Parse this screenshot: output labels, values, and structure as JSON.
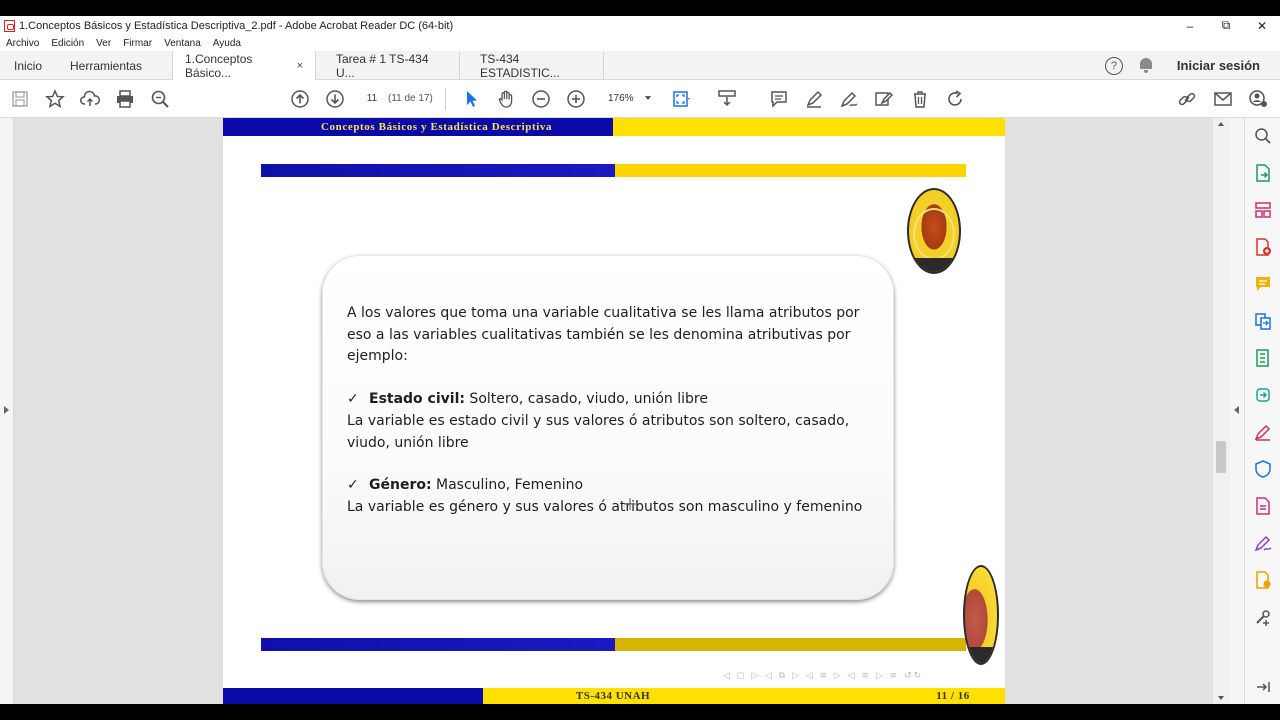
{
  "window": {
    "title": "1.Conceptos Básicos y Estadística Descriptiva_2.pdf - Adobe Acrobat Reader DC (64-bit)",
    "minimize": "–",
    "restore": "⧉",
    "close": "✕"
  },
  "menu": [
    "Archivo",
    "Edición",
    "Ver",
    "Firmar",
    "Ventana",
    "Ayuda"
  ],
  "tabs": {
    "home": "Inicio",
    "tools": "Herramientas",
    "doc1": "1.Conceptos Básico...",
    "doc1_close": "×",
    "doc2": "Tarea # 1 TS-434 U...",
    "doc3": "TS-434 ESTADISTIC...",
    "help": "?",
    "signin": "Iniciar sesión"
  },
  "toolbar": {
    "page_current": "11",
    "page_count": "(11 de 17)",
    "zoom": "176%"
  },
  "slide": {
    "header": "Conceptos Básicos y Estadística Descriptiva",
    "para1": "A los valores que toma una  variable cualitativa se les llama atributos por eso a las variables cualitativas también se les denomina atributivas por ejemplo:",
    "check": "✓",
    "item1_label": "Estado civil:",
    "item1_values": " Soltero, casado, viudo, unión libre",
    "item1_desc": "La variable es estado civil y sus valores ó atributos son soltero, casado, viudo, unión libre",
    "item2_label": "Género:",
    "item2_values": " Masculino, Femenino",
    "item2_desc": "La variable es género y sus valores ó atributos son masculino y femenino",
    "footer_left": "TS-434 UNAH",
    "footer_page": "11 / 16",
    "nav_glyphs": "◁ ◻ ▷ ◁ ⧉ ▷ ◁ ≡ ▷ ◁ ≡ ▷ ≡ ↺↻"
  },
  "colors": {
    "slide_blue": "#0a0aa8",
    "slide_yellow": "#ffe000",
    "header_text": "#ffe34a"
  },
  "icons": {
    "toolbar": [
      "save-icon",
      "bookmark-star-icon",
      "upload-cloud-icon",
      "print-icon",
      "search-zoom-icon",
      "prev-page-icon",
      "next-page-icon",
      "select-arrow-icon",
      "hand-tool-icon",
      "zoom-out-icon",
      "zoom-in-icon",
      "fit-page-icon",
      "scroll-mode-icon",
      "comment-icon",
      "highlight-pen-icon",
      "sign-icon",
      "edit-stamp-icon",
      "delete-icon",
      "rotate-icon",
      "share-link-icon",
      "email-icon",
      "user-share-icon"
    ],
    "right_panel": [
      "zoom-search-icon",
      "export-pdf-icon",
      "organize-pages-icon",
      "create-pdf-icon",
      "comment-icon",
      "combine-files-icon",
      "compress-icon",
      "protect-icon",
      "fill-sign-icon",
      "shield-icon",
      "scan-icon",
      "edit-pdf-icon",
      "send-review-icon",
      "more-tools-icon",
      "collapse-panel-icon"
    ]
  }
}
